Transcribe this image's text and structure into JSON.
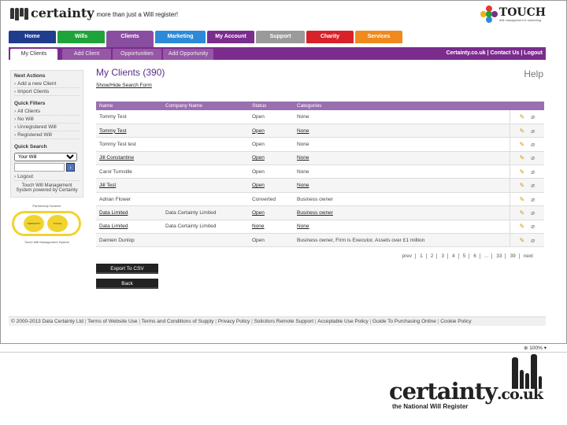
{
  "header": {
    "logo_name": "certainty",
    "logo_tagline": "more than just a Will register!",
    "partner_name": "TOUCH",
    "partner_tagline": "Will management & marketing"
  },
  "main_nav": [
    {
      "label": "Home",
      "color": "#1f3d8c",
      "width": 60
    },
    {
      "label": "Wills",
      "color": "#1fa33a",
      "width": 60
    },
    {
      "label": "Clients",
      "color": "#8a4ea0",
      "width": 60,
      "active": true
    },
    {
      "label": "Marketing",
      "color": "#2c8ad9",
      "width": 64
    },
    {
      "label": "My Account",
      "color": "#7b2d8e",
      "width": 60
    },
    {
      "label": "Support",
      "color": "#9a9a9a",
      "width": 62
    },
    {
      "label": "Charity",
      "color": "#d8222a",
      "width": 60
    },
    {
      "label": "Services",
      "color": "#f08a1c",
      "width": 60
    }
  ],
  "sub_nav": {
    "tabs": [
      "My Clients",
      "Add Client",
      "Opportunities",
      "Add Opportunity"
    ],
    "links": "Certainty.co.uk | Contact Us | Logout"
  },
  "sidebar": {
    "next_actions_title": "Next Actions",
    "next_actions": [
      "Add a new Client",
      "Import Clients"
    ],
    "quick_filters_title": "Quick Filters",
    "quick_filters": [
      "All Clients",
      "No Will",
      "Unregistered Will",
      "Registered Will"
    ],
    "quick_search_title": "Quick Search",
    "search_select": "Your Will",
    "search_button": "›",
    "logout": "Logout",
    "powered_by": "Touch Will Management System powered by Certainty",
    "badge_caption": "Partnership Scheme",
    "badge_sub": "Touch Will Management System",
    "badge_left": "CERTAINTY",
    "badge_right": "TOUCH"
  },
  "content": {
    "title": "My Clients (390)",
    "help": "Help",
    "search_toggle": "Show/Hide Search Form",
    "columns": [
      "Name",
      "Company Name",
      "Status",
      "Categories"
    ],
    "rows": [
      {
        "name": "Tommy Test",
        "company": "",
        "status": "Open",
        "categories": "None",
        "linked": false
      },
      {
        "name": "Tommy Test",
        "company": "",
        "status": "Open",
        "categories": "None",
        "linked": true
      },
      {
        "name": "Tommy Test test",
        "company": "",
        "status": "Open",
        "categories": "None",
        "linked": false
      },
      {
        "name": "Jill Constantine",
        "company": "",
        "status": "Open",
        "categories": "None",
        "linked": true
      },
      {
        "name": "Carol Turnstile",
        "company": "",
        "status": "Open",
        "categories": "None",
        "linked": false
      },
      {
        "name": "Jill Test",
        "company": "",
        "status": "Open",
        "categories": "None",
        "linked": true
      },
      {
        "name": "Adrian Flower",
        "company": "",
        "status": "Converted",
        "categories": "Business owner",
        "linked": false
      },
      {
        "name": "Data Limited",
        "company": "Data Certainty Limited",
        "status": "Open",
        "categories": "Business owner",
        "linked": true
      },
      {
        "name": "Data Limited",
        "company": "Data Certainty Limited",
        "status": "None",
        "categories": "None",
        "linked": true
      },
      {
        "name": "Damien Dunlop",
        "company": "",
        "status": "Open",
        "categories": "Business owner, Firm is Executor, Assets over £1 million",
        "linked": false
      }
    ],
    "pager": [
      "prev",
      "1",
      "2",
      "3",
      "4",
      "5",
      "6",
      "...",
      "33",
      "39",
      "next"
    ],
    "export_button": "Export To CSV",
    "back_button": "Back"
  },
  "footer": [
    "© 2000-2013 Data Certainty Ltd",
    "Terms of Website Use",
    "Terms and Conditions of Supply",
    "Privacy Policy",
    "Solicitors Remote Support",
    "Acceptable Use Policy",
    "Guide To Purchasing Online",
    "Cookie Policy"
  ],
  "statusbar": {
    "zoom": "100%"
  },
  "slide_logo": {
    "word": "certainty",
    "suffix": ".co.uk",
    "tagline": "the National Will Register"
  }
}
